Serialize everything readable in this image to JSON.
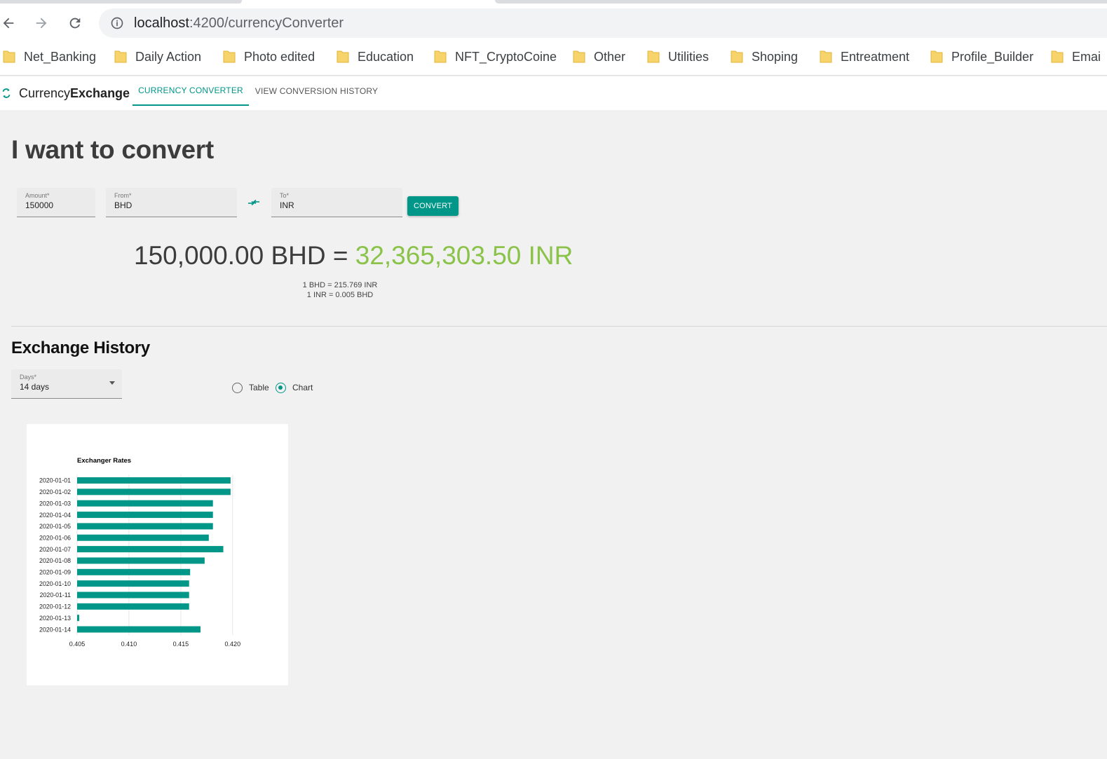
{
  "browser": {
    "url_host": "localhost",
    "url_path": ":4200/currencyConverter",
    "bookmarks": [
      {
        "label": "Net_Banking"
      },
      {
        "label": "Daily Action"
      },
      {
        "label": "Photo edited"
      },
      {
        "label": "Education"
      },
      {
        "label": "NFT_CryptoCoine"
      },
      {
        "label": "Other"
      },
      {
        "label": "Utilities"
      },
      {
        "label": "Shoping"
      },
      {
        "label": "Entreatment"
      },
      {
        "label": "Profile_Builder"
      },
      {
        "label": "Emai"
      }
    ]
  },
  "app": {
    "brand_light": "Currency",
    "brand_bold": "Exchange",
    "tabs": [
      {
        "label": "CURRENCY CONVERTER",
        "active": true
      },
      {
        "label": "VIEW CONVERSION HISTORY",
        "active": false
      }
    ],
    "accent_color": "#009688",
    "result_color": "#8bc34a"
  },
  "converter": {
    "heading": "I want to convert",
    "amount_label": "Amount*",
    "amount_value": "150000",
    "from_label": "From*",
    "from_value": "BHD",
    "to_label": "To*",
    "to_value": "INR",
    "convert_label": "CONVERT",
    "result_from": "150,000.00 BHD = ",
    "result_to": "32,365,303.50 INR",
    "rate_forward": "1 BHD = 215.769 INR",
    "rate_reverse": "1 INR = 0.005 BHD"
  },
  "history": {
    "heading": "Exchange History",
    "days_label": "Days*",
    "days_value": "14 days",
    "view_options": [
      {
        "label": "Table",
        "selected": false
      },
      {
        "label": "Chart",
        "selected": true
      }
    ]
  },
  "chart_data": {
    "type": "bar",
    "orientation": "horizontal",
    "title": "Exchanger Rates",
    "categories": [
      "2020-01-01",
      "2020-01-02",
      "2020-01-03",
      "2020-01-04",
      "2020-01-05",
      "2020-01-06",
      "2020-01-07",
      "2020-01-08",
      "2020-01-09",
      "2020-01-10",
      "2020-01-11",
      "2020-01-12",
      "2020-01-13",
      "2020-01-14"
    ],
    "values": [
      0.4198,
      0.4198,
      0.4181,
      0.4181,
      0.4181,
      0.4177,
      0.4191,
      0.4173,
      0.4159,
      0.4158,
      0.4158,
      0.4158,
      0.4052,
      0.4169
    ],
    "xlim": [
      0.405,
      0.4215
    ],
    "xticks": [
      0.405,
      0.41,
      0.415,
      0.42
    ],
    "xtick_labels": [
      "0.405",
      "0.410",
      "0.415",
      "0.420"
    ],
    "grid": true,
    "bar_color": "#009688"
  }
}
